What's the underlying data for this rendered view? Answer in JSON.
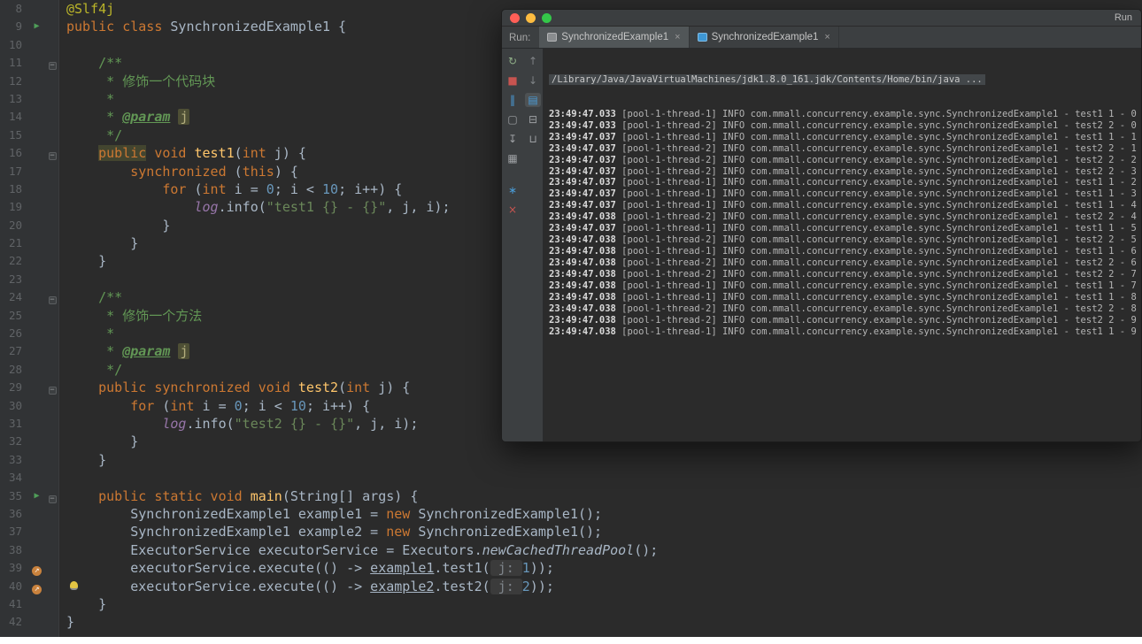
{
  "editor": {
    "lines": [
      {
        "n": 8,
        "t": [
          [
            "a",
            "@Slf4j"
          ]
        ]
      },
      {
        "n": 9,
        "g": "run",
        "t": [
          [
            "k",
            "public class "
          ],
          [
            "d",
            "SynchronizedExample1 {"
          ]
        ]
      },
      {
        "n": 10,
        "t": []
      },
      {
        "n": 11,
        "fold": true,
        "t": [
          [
            "c",
            "    /**"
          ]
        ]
      },
      {
        "n": 12,
        "t": [
          [
            "c",
            "     * 修饰一个代码块"
          ]
        ]
      },
      {
        "n": 13,
        "t": [
          [
            "c",
            "     *"
          ]
        ]
      },
      {
        "n": 14,
        "t": [
          [
            "c",
            "     * "
          ],
          [
            "ct",
            "@param"
          ],
          [
            "c",
            " "
          ],
          [
            "cp",
            "j"
          ]
        ]
      },
      {
        "n": 15,
        "t": [
          [
            "c",
            "     */"
          ]
        ]
      },
      {
        "n": 16,
        "fold": true,
        "t": [
          [
            "d",
            "    "
          ],
          [
            "hl",
            "public"
          ],
          [
            "k",
            " void "
          ],
          [
            "m",
            "test1"
          ],
          [
            "d",
            "("
          ],
          [
            "k",
            "int"
          ],
          [
            "d",
            " j) {"
          ]
        ]
      },
      {
        "n": 17,
        "t": [
          [
            "d",
            "        "
          ],
          [
            "k",
            "synchronized"
          ],
          [
            "d",
            " ("
          ],
          [
            "k",
            "this"
          ],
          [
            "d",
            ") {"
          ]
        ]
      },
      {
        "n": 18,
        "t": [
          [
            "d",
            "            "
          ],
          [
            "k",
            "for"
          ],
          [
            "d",
            " ("
          ],
          [
            "k",
            "int"
          ],
          [
            "d",
            " i = "
          ],
          [
            "n",
            "0"
          ],
          [
            "d",
            "; i < "
          ],
          [
            "n",
            "10"
          ],
          [
            "d",
            "; i++) {"
          ]
        ]
      },
      {
        "n": 19,
        "t": [
          [
            "d",
            "                "
          ],
          [
            "f",
            "log"
          ],
          [
            "d",
            ".info("
          ],
          [
            "s",
            "\"test1 {} - {}\""
          ],
          [
            "d",
            ", j, i);"
          ]
        ]
      },
      {
        "n": 20,
        "t": [
          [
            "d",
            "            }"
          ]
        ]
      },
      {
        "n": 21,
        "t": [
          [
            "d",
            "        }"
          ]
        ]
      },
      {
        "n": 22,
        "t": [
          [
            "d",
            "    }"
          ]
        ]
      },
      {
        "n": 23,
        "t": []
      },
      {
        "n": 24,
        "fold": true,
        "t": [
          [
            "c",
            "    /**"
          ]
        ]
      },
      {
        "n": 25,
        "t": [
          [
            "c",
            "     * 修饰一个方法"
          ]
        ]
      },
      {
        "n": 26,
        "t": [
          [
            "c",
            "     *"
          ]
        ]
      },
      {
        "n": 27,
        "t": [
          [
            "c",
            "     * "
          ],
          [
            "ct",
            "@param"
          ],
          [
            "c",
            " "
          ],
          [
            "cp",
            "j"
          ]
        ]
      },
      {
        "n": 28,
        "t": [
          [
            "c",
            "     */"
          ]
        ]
      },
      {
        "n": 29,
        "fold": true,
        "t": [
          [
            "d",
            "    "
          ],
          [
            "k",
            "public synchronized void "
          ],
          [
            "m",
            "test2"
          ],
          [
            "d",
            "("
          ],
          [
            "k",
            "int"
          ],
          [
            "d",
            " j) {"
          ]
        ]
      },
      {
        "n": 30,
        "t": [
          [
            "d",
            "        "
          ],
          [
            "k",
            "for"
          ],
          [
            "d",
            " ("
          ],
          [
            "k",
            "int"
          ],
          [
            "d",
            " i = "
          ],
          [
            "n",
            "0"
          ],
          [
            "d",
            "; i < "
          ],
          [
            "n",
            "10"
          ],
          [
            "d",
            "; i++) {"
          ]
        ]
      },
      {
        "n": 31,
        "t": [
          [
            "d",
            "            "
          ],
          [
            "f",
            "log"
          ],
          [
            "d",
            ".info("
          ],
          [
            "s",
            "\"test2 {} - {}\""
          ],
          [
            "d",
            ", j, i);"
          ]
        ]
      },
      {
        "n": 32,
        "t": [
          [
            "d",
            "        }"
          ]
        ]
      },
      {
        "n": 33,
        "t": [
          [
            "d",
            "    }"
          ]
        ]
      },
      {
        "n": 34,
        "t": []
      },
      {
        "n": 35,
        "g": "run",
        "fold": true,
        "t": [
          [
            "d",
            "    "
          ],
          [
            "k",
            "public static void "
          ],
          [
            "m",
            "main"
          ],
          [
            "d",
            "(String[] args) {"
          ]
        ]
      },
      {
        "n": 36,
        "t": [
          [
            "d",
            "        SynchronizedExample1 example1 = "
          ],
          [
            "k",
            "new"
          ],
          [
            "d",
            " SynchronizedExample1();"
          ]
        ]
      },
      {
        "n": 37,
        "t": [
          [
            "d",
            "        SynchronizedExample1 example2 = "
          ],
          [
            "k",
            "new"
          ],
          [
            "d",
            " SynchronizedExample1();"
          ]
        ]
      },
      {
        "n": 38,
        "t": [
          [
            "d",
            "        ExecutorService executorService = Executors."
          ],
          [
            "i",
            "newCachedThreadPool"
          ],
          [
            "d",
            "();"
          ]
        ]
      },
      {
        "n": 39,
        "g": "bp",
        "t": [
          [
            "d",
            "        executorService.execute(() -> "
          ],
          [
            "u",
            "example1"
          ],
          [
            "d",
            ".test1("
          ],
          [
            "h",
            " j: "
          ],
          [
            "n",
            "1"
          ],
          [
            "d",
            "));"
          ]
        ]
      },
      {
        "n": 40,
        "g": "bp",
        "bulb": true,
        "t": [
          [
            "d",
            "        executorService.execute(() -> "
          ],
          [
            "u",
            "example2"
          ],
          [
            "d",
            ".test2("
          ],
          [
            "h",
            " j: "
          ],
          [
            "n",
            "2"
          ],
          [
            "d",
            "));"
          ]
        ]
      },
      {
        "n": 41,
        "t": [
          [
            "d",
            "    }"
          ]
        ]
      },
      {
        "n": 42,
        "t": [
          [
            "d",
            "}"
          ]
        ]
      }
    ],
    "gutter_icons": {
      "run": {
        "name": "run-button-icon",
        "glyph": "▶",
        "color": "#4f9e58"
      },
      "bp": {
        "name": "orange-arrow-circle-icon",
        "glyph": "↗",
        "color": "#c9823d"
      },
      "bulb": {
        "name": "intention-bulb-icon",
        "color": "#e3c443"
      },
      "fold": {
        "name": "fold-marker",
        "glyph": "−"
      }
    },
    "colors": {
      "background": "#2b2b2b",
      "gutter_background": "#313335",
      "keyword": "#cc7832",
      "annotation": "#bbb529",
      "string": "#6a8759",
      "number": "#6897bb",
      "comment": "#629755",
      "method": "#ffc66b",
      "default_text": "#a9b7c6",
      "line_number": "#606366"
    }
  },
  "run_window": {
    "title": "Run",
    "tab_prefix": "Run:",
    "traffic_lights": [
      {
        "name": "close",
        "color": "#ff5f57"
      },
      {
        "name": "minimize",
        "color": "#fdbc40"
      },
      {
        "name": "zoom",
        "color": "#34c749"
      }
    ],
    "tabs": [
      {
        "label": "SynchronizedExample1",
        "close": "×",
        "icon_color": "#8a8d8f",
        "active": true
      },
      {
        "label": "SynchronizedExample1",
        "close": "×",
        "icon_color": "#3e97d4",
        "active": false
      }
    ],
    "toolbar_left": [
      {
        "name": "rerun-icon",
        "glyph": "↻",
        "color": "#8fae87"
      },
      {
        "name": "stop-icon",
        "glyph": "■",
        "color": "#c75450"
      },
      {
        "name": "pause-output-icon",
        "glyph": "‖",
        "color": "#4a9bd5"
      },
      {
        "name": "restore-layout-icon",
        "glyph": "▢",
        "color": "#9da0a3"
      },
      {
        "name": "scroll-to-end-icon",
        "glyph": "↧",
        "color": "#9da0a3"
      },
      {
        "name": "dump-threads-icon",
        "glyph": "▦",
        "color": "#9da0a3"
      },
      {
        "name": "gc-icon",
        "glyph": "∗",
        "color": "#4a9bd5",
        "gap": true
      },
      {
        "name": "close-console-icon",
        "glyph": "×",
        "color": "#c75450"
      }
    ],
    "toolbar_right": [
      {
        "name": "prev-occurrence-icon",
        "glyph": "↑",
        "color": "#7f8386"
      },
      {
        "name": "next-occurrence-icon",
        "glyph": "↓",
        "color": "#7f8386"
      },
      {
        "name": "soft-wrap-icon",
        "glyph": "▤",
        "color": "#4a9bd5",
        "selected": true
      },
      {
        "name": "print-icon",
        "glyph": "⊟",
        "color": "#9da0a3"
      },
      {
        "name": "clear-all-icon",
        "glyph": "⊔",
        "color": "#9da0a3"
      }
    ],
    "console": {
      "header": "/Library/Java/JavaVirtualMachines/jdk1.8.0_161.jdk/Contents/Home/bin/java ...",
      "lines": [
        "23:49:47.033 [pool-1-thread-1] INFO com.mmall.concurrency.example.sync.SynchronizedExample1 - test1 1 - 0",
        "23:49:47.033 [pool-1-thread-2] INFO com.mmall.concurrency.example.sync.SynchronizedExample1 - test2 2 - 0",
        "23:49:47.037 [pool-1-thread-1] INFO com.mmall.concurrency.example.sync.SynchronizedExample1 - test1 1 - 1",
        "23:49:47.037 [pool-1-thread-2] INFO com.mmall.concurrency.example.sync.SynchronizedExample1 - test2 2 - 1",
        "23:49:47.037 [pool-1-thread-2] INFO com.mmall.concurrency.example.sync.SynchronizedExample1 - test2 2 - 2",
        "23:49:47.037 [pool-1-thread-2] INFO com.mmall.concurrency.example.sync.SynchronizedExample1 - test2 2 - 3",
        "23:49:47.037 [pool-1-thread-1] INFO com.mmall.concurrency.example.sync.SynchronizedExample1 - test1 1 - 2",
        "23:49:47.037 [pool-1-thread-1] INFO com.mmall.concurrency.example.sync.SynchronizedExample1 - test1 1 - 3",
        "23:49:47.037 [pool-1-thread-1] INFO com.mmall.concurrency.example.sync.SynchronizedExample1 - test1 1 - 4",
        "23:49:47.038 [pool-1-thread-2] INFO com.mmall.concurrency.example.sync.SynchronizedExample1 - test2 2 - 4",
        "23:49:47.037 [pool-1-thread-1] INFO com.mmall.concurrency.example.sync.SynchronizedExample1 - test1 1 - 5",
        "23:49:47.038 [pool-1-thread-2] INFO com.mmall.concurrency.example.sync.SynchronizedExample1 - test2 2 - 5",
        "23:49:47.038 [pool-1-thread-1] INFO com.mmall.concurrency.example.sync.SynchronizedExample1 - test1 1 - 6",
        "23:49:47.038 [pool-1-thread-2] INFO com.mmall.concurrency.example.sync.SynchronizedExample1 - test2 2 - 6",
        "23:49:47.038 [pool-1-thread-2] INFO com.mmall.concurrency.example.sync.SynchronizedExample1 - test2 2 - 7",
        "23:49:47.038 [pool-1-thread-1] INFO com.mmall.concurrency.example.sync.SynchronizedExample1 - test1 1 - 7",
        "23:49:47.038 [pool-1-thread-1] INFO com.mmall.concurrency.example.sync.SynchronizedExample1 - test1 1 - 8",
        "23:49:47.038 [pool-1-thread-2] INFO com.mmall.concurrency.example.sync.SynchronizedExample1 - test2 2 - 8",
        "23:49:47.038 [pool-1-thread-2] INFO com.mmall.concurrency.example.sync.SynchronizedExample1 - test2 2 - 9",
        "23:49:47.038 [pool-1-thread-1] INFO com.mmall.concurrency.example.sync.SynchronizedExample1 - test1 1 - 9"
      ]
    }
  }
}
